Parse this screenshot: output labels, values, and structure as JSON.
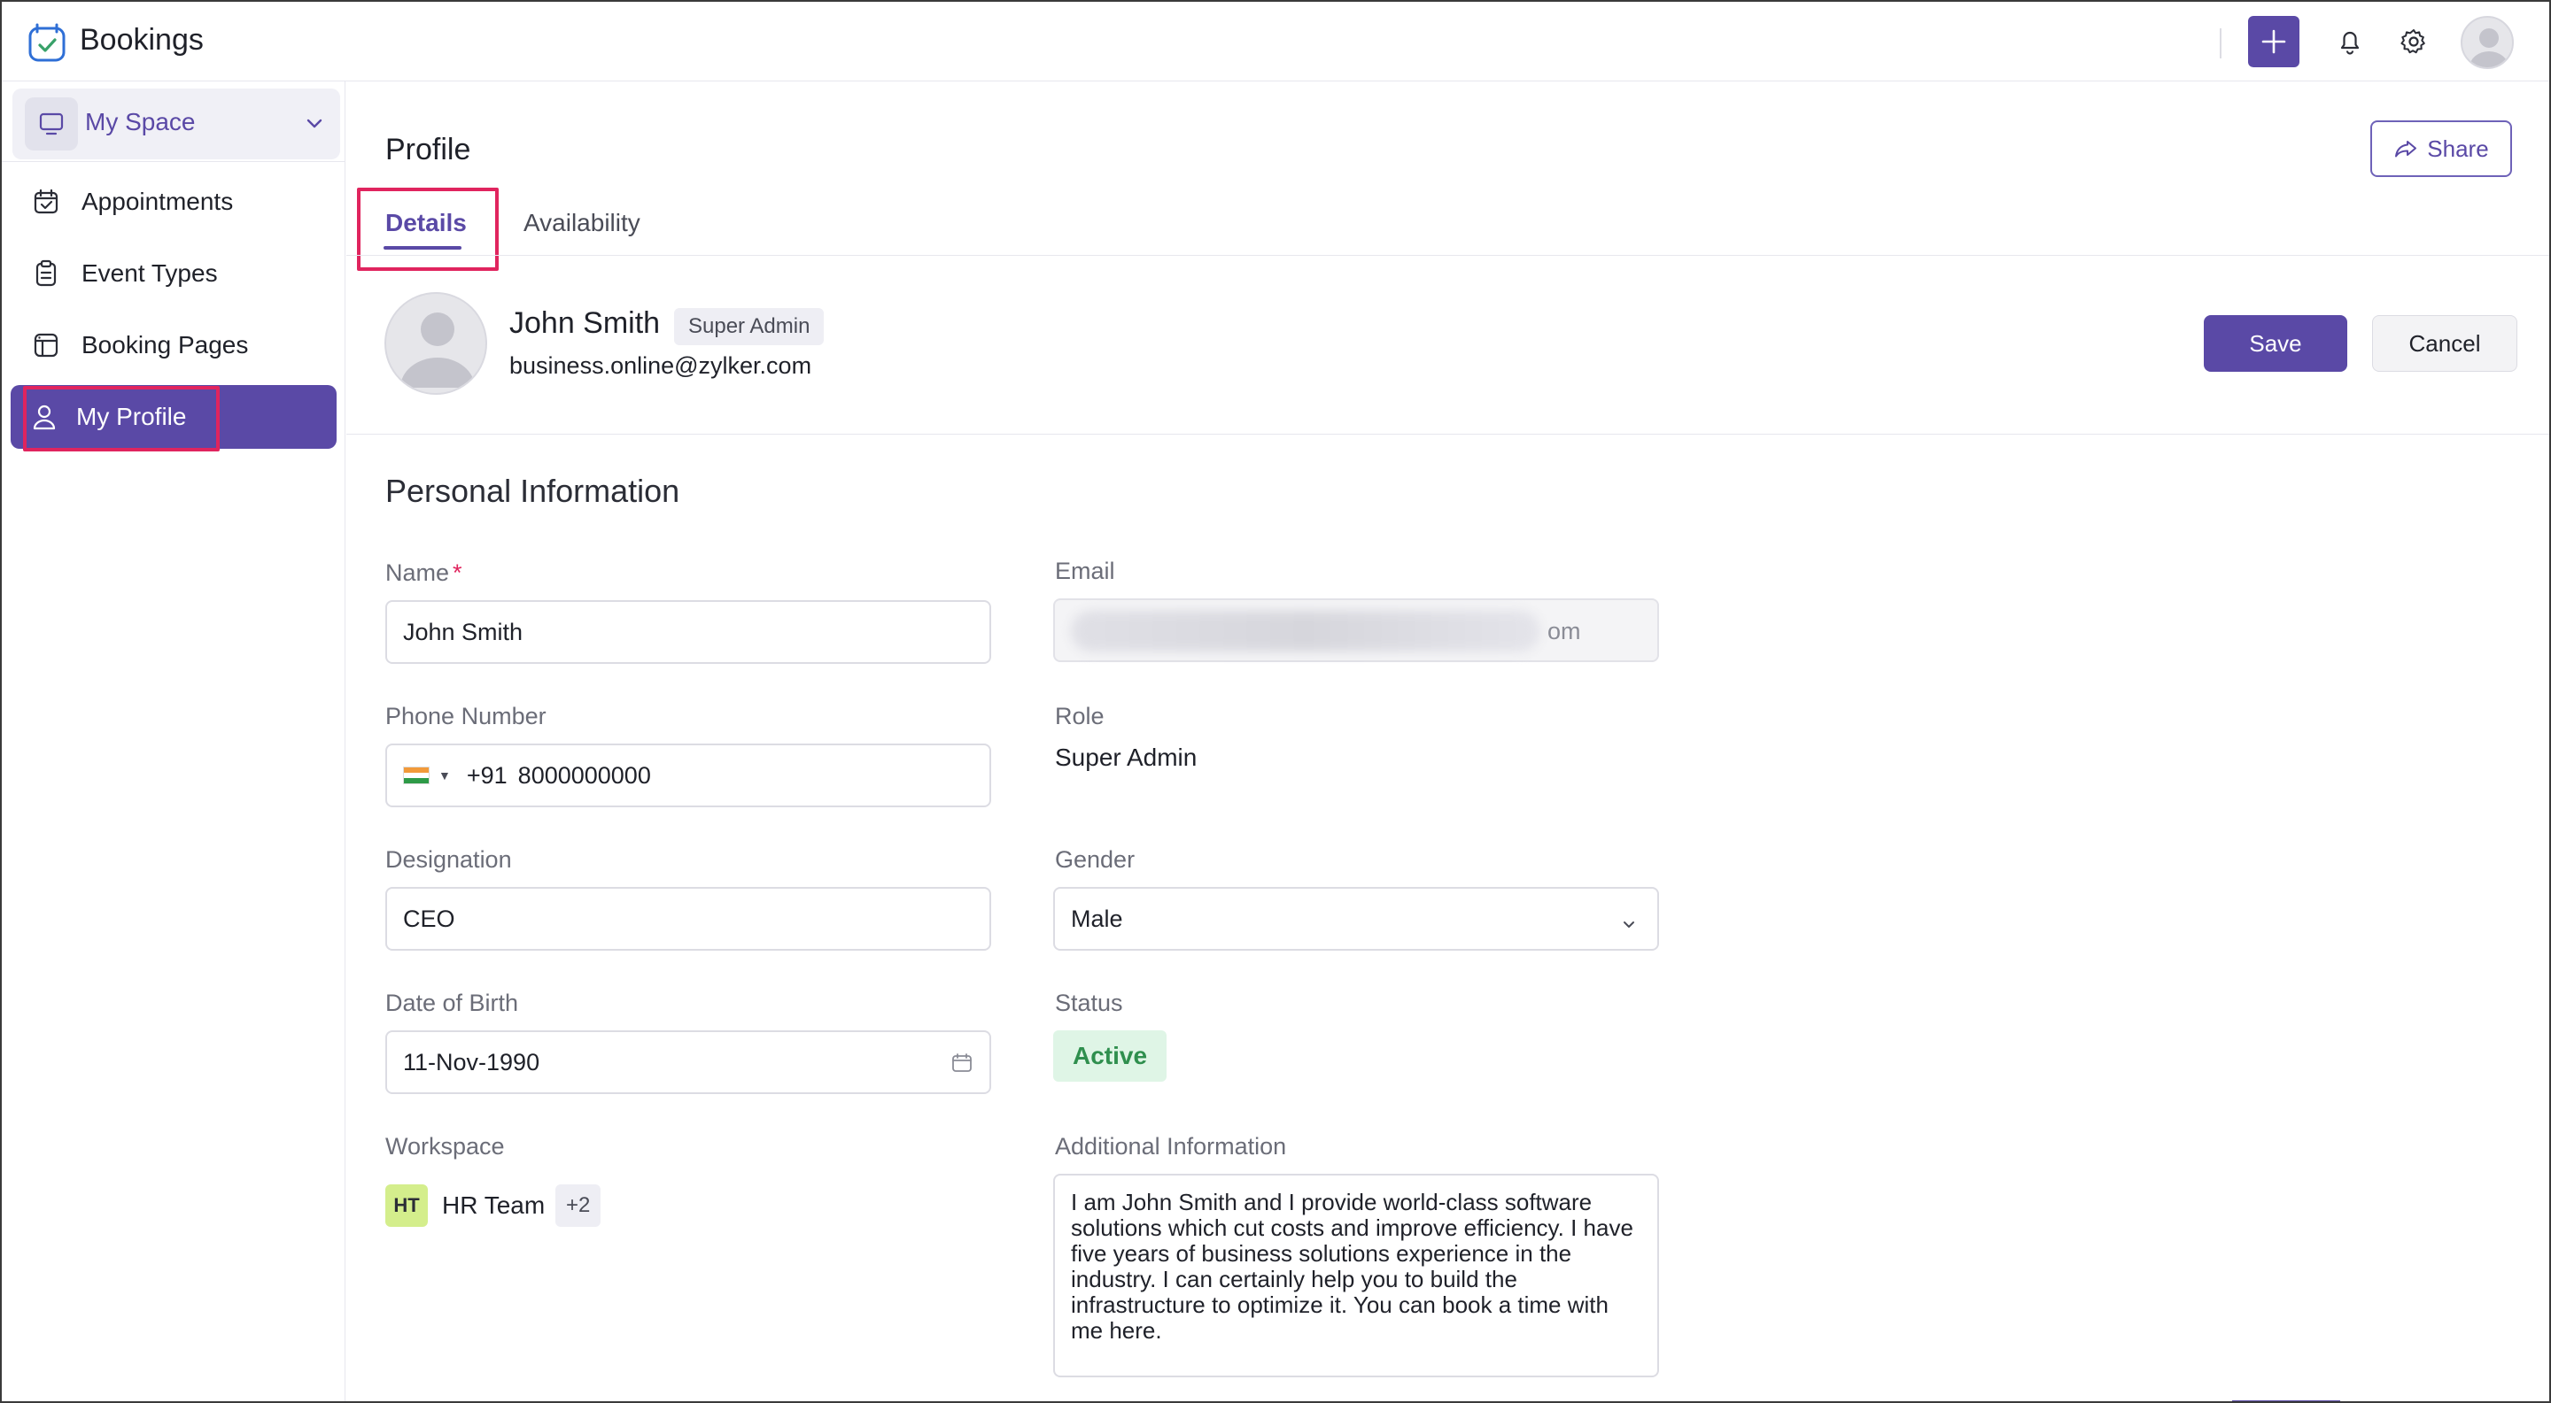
{
  "app": {
    "title": "Bookings"
  },
  "colors": {
    "accent": "#5a49a6",
    "highlight": "#e0245e",
    "status_active_bg": "#dff5e6",
    "status_active_text": "#2f8f4e"
  },
  "topbar": {
    "icons": [
      "plus-icon",
      "bell-icon",
      "gear-icon",
      "avatar"
    ]
  },
  "sidebar": {
    "space": {
      "label": "My Space",
      "icon": "monitor-icon"
    },
    "items": [
      {
        "label": "Appointments",
        "icon": "calendar-check-icon"
      },
      {
        "label": "Event Types",
        "icon": "clipboard-icon"
      },
      {
        "label": "Booking Pages",
        "icon": "layout-icon"
      },
      {
        "label": "My Profile",
        "icon": "user-icon",
        "active": true
      }
    ]
  },
  "page": {
    "title": "Profile",
    "share_label": "Share",
    "tabs": [
      {
        "label": "Details",
        "active": true
      },
      {
        "label": "Availability",
        "active": false
      }
    ]
  },
  "profile": {
    "name": "John Smith",
    "role_badge": "Super Admin",
    "email": "business.online@zylker.com",
    "save_label": "Save",
    "cancel_label": "Cancel"
  },
  "personal": {
    "section_title": "Personal Information",
    "name_label": "Name",
    "name_required": "*",
    "name_value": "John Smith",
    "email_label": "Email",
    "email_suffix": "om",
    "phone_label": "Phone Number",
    "phone_code": "+91",
    "phone_number": "8000000000",
    "role_label": "Role",
    "role_value": "Super Admin",
    "designation_label": "Designation",
    "designation_value": "CEO",
    "gender_label": "Gender",
    "gender_value": "Male",
    "dob_label": "Date of Birth",
    "dob_value": "11-Nov-1990",
    "status_label": "Status",
    "status_value": "Active",
    "workspace_label": "Workspace",
    "workspace_initials": "HT",
    "workspace_name": "HR Team",
    "workspace_more": "+2",
    "additional_label": "Additional Information",
    "additional_value": "I am John Smith and I provide world-class software solutions which cut costs and improve efficiency. I have five years of business solutions experience in the industry. I can certainly help you to build the infrastructure to optimize it. You can book a time with me here."
  }
}
